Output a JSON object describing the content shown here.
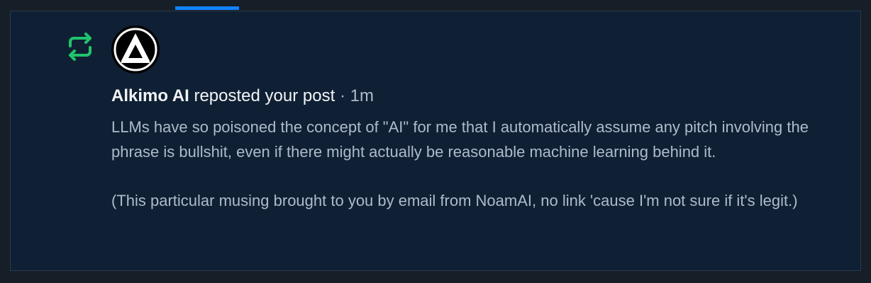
{
  "notification": {
    "author": "Alkimo AI",
    "action": "reposted your post",
    "separator": "·",
    "time": "1m",
    "post_paragraphs": [
      "LLMs have so poisoned the concept of \"AI\" for me that I automatically assume any pitch involving the phrase is bullshit, even if there might actually be reasonable machine learning behind it.",
      "(This particular musing brought to you by email from NoamAI, no link 'cause I'm not sure if it's legit.)"
    ],
    "icon": "repost-icon",
    "avatar_icon": "alkimo-logo-icon"
  },
  "colors": {
    "background": "#161e27",
    "card": "#0f2035",
    "accent": "#1083fe",
    "repost_green": "#20c46b",
    "text_primary": "#f1f3f5",
    "text_secondary": "#aebbc9"
  }
}
